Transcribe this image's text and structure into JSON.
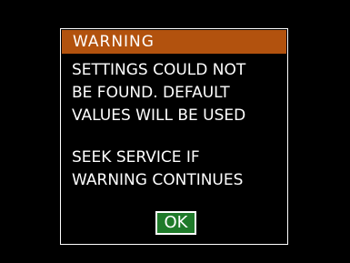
{
  "dialog": {
    "title": "WARNING",
    "message_lines_1": "SETTINGS COULD NOT\nBE FOUND. DEFAULT\nVALUES WILL BE USED",
    "message_lines_2": "SEEK SERVICE IF\nWARNING CONTINUES",
    "ok_label": "OK"
  },
  "colors": {
    "background": "#000000",
    "title_bar": "#b2520e",
    "ok_button": "#1f7a2a",
    "text": "#ffffff",
    "border": "#ffffff"
  }
}
